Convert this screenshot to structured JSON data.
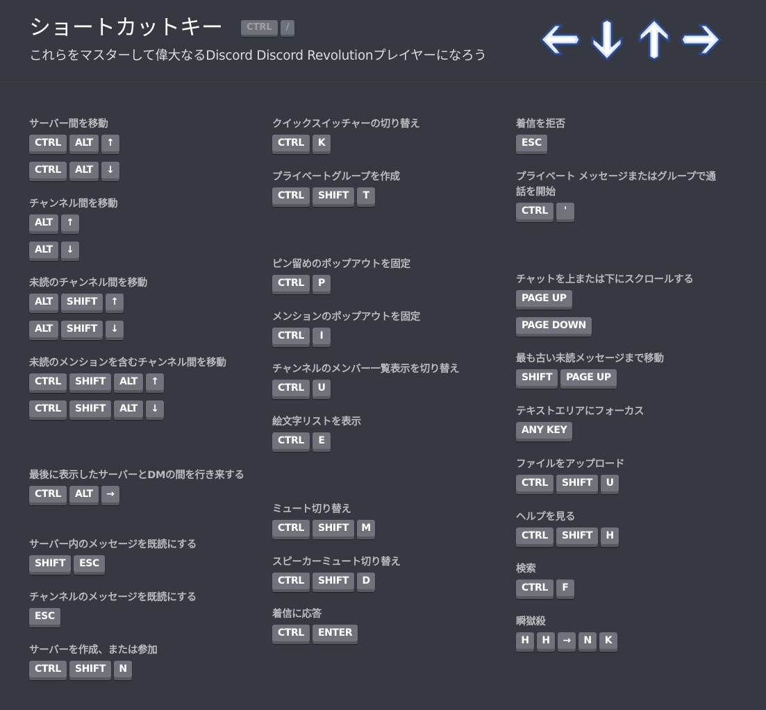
{
  "header": {
    "title": "ショートカットキー",
    "title_keys": [
      "CTRL",
      "/"
    ],
    "subtitle": "これらをマスターして偉大なるDiscord Discord Revolutionプレイヤーになろう",
    "arrow_icons": [
      "arrow-left-icon",
      "arrow-down-icon",
      "arrow-up-icon",
      "arrow-right-icon"
    ],
    "arrow_colors": {
      "fill": "#ffffff",
      "inner": "#d9e4ff",
      "outline": "#2a4a8a"
    }
  },
  "colors": {
    "background": "#363942",
    "key_face": "#70737b",
    "key_shadow": "#565960",
    "label": "#b9bbbe",
    "title": "#ffffff"
  },
  "columns": [
    {
      "shortcuts": [
        {
          "label": "サーバー間を移動",
          "combos": [
            [
              "CTRL",
              "ALT",
              "↑"
            ],
            [
              "CTRL",
              "ALT",
              "↓"
            ]
          ]
        },
        {
          "label": "チャンネル間を移動",
          "combos": [
            [
              "ALT",
              "↑"
            ],
            [
              "ALT",
              "↓"
            ]
          ]
        },
        {
          "label": "未読のチャンネル間を移動",
          "combos": [
            [
              "ALT",
              "SHIFT",
              "↑"
            ],
            [
              "ALT",
              "SHIFT",
              "↓"
            ]
          ]
        },
        {
          "label": "未読のメンションを含むチャンネル間を移動",
          "combos": [
            [
              "CTRL",
              "SHIFT",
              "ALT",
              "↑"
            ],
            [
              "CTRL",
              "SHIFT",
              "ALT",
              "↓"
            ]
          ]
        },
        {
          "label": "最後に表示したサーバーとDMの間を行き来する",
          "combos": [
            [
              "CTRL",
              "ALT",
              "→"
            ]
          ]
        },
        {
          "label": "サーバー内のメッセージを既読にする",
          "combos": [
            [
              "SHIFT",
              "ESC"
            ]
          ]
        },
        {
          "label": "チャンネルのメッセージを既読にする",
          "combos": [
            [
              "ESC"
            ]
          ]
        },
        {
          "label": "サーバーを作成、または参加",
          "combos": [
            [
              "CTRL",
              "SHIFT",
              "N"
            ]
          ]
        }
      ]
    },
    {
      "shortcuts": [
        {
          "label": "クイックスイッチャーの切り替え",
          "combos": [
            [
              "CTRL",
              "K"
            ]
          ]
        },
        {
          "label": "プライベートグループを作成",
          "combos": [
            [
              "CTRL",
              "SHIFT",
              "T"
            ]
          ]
        },
        {
          "label": "ピン留めのポップアウトを固定",
          "combos": [
            [
              "CTRL",
              "P"
            ]
          ]
        },
        {
          "label": "メンションのポップアウトを固定",
          "combos": [
            [
              "CTRL",
              "I"
            ]
          ]
        },
        {
          "label": "チャンネルのメンバー一覧表示を切り替え",
          "combos": [
            [
              "CTRL",
              "U"
            ]
          ]
        },
        {
          "label": "絵文字リストを表示",
          "combos": [
            [
              "CTRL",
              "E"
            ]
          ]
        },
        {
          "label": "ミュート切り替え",
          "combos": [
            [
              "CTRL",
              "SHIFT",
              "M"
            ]
          ]
        },
        {
          "label": "スピーカーミュート切り替え",
          "combos": [
            [
              "CTRL",
              "SHIFT",
              "D"
            ]
          ]
        },
        {
          "label": "着信に応答",
          "combos": [
            [
              "CTRL",
              "ENTER"
            ]
          ]
        }
      ]
    },
    {
      "shortcuts": [
        {
          "label": "着信を拒否",
          "combos": [
            [
              "ESC"
            ]
          ]
        },
        {
          "label": "プライベート メッセージまたはグループで通話を開始",
          "combos": [
            [
              "CTRL",
              "'"
            ]
          ]
        },
        {
          "label": "チャットを上または下にスクロールする",
          "combos": [
            [
              "PAGE UP"
            ],
            [
              "PAGE DOWN"
            ]
          ]
        },
        {
          "label": "最も古い未読メッセージまで移動",
          "combos": [
            [
              "SHIFT",
              "PAGE UP"
            ]
          ]
        },
        {
          "label": "テキストエリアにフォーカス",
          "combos": [
            [
              "ANY KEY"
            ]
          ]
        },
        {
          "label": "ファイルをアップロード",
          "combos": [
            [
              "CTRL",
              "SHIFT",
              "U"
            ]
          ]
        },
        {
          "label": "ヘルプを見る",
          "combos": [
            [
              "CTRL",
              "SHIFT",
              "H"
            ]
          ]
        },
        {
          "label": "検索",
          "combos": [
            [
              "CTRL",
              "F"
            ]
          ]
        },
        {
          "label": "瞬獄殺",
          "combos": [
            [
              "H",
              "H",
              "→",
              "N",
              "K"
            ]
          ]
        }
      ]
    }
  ]
}
